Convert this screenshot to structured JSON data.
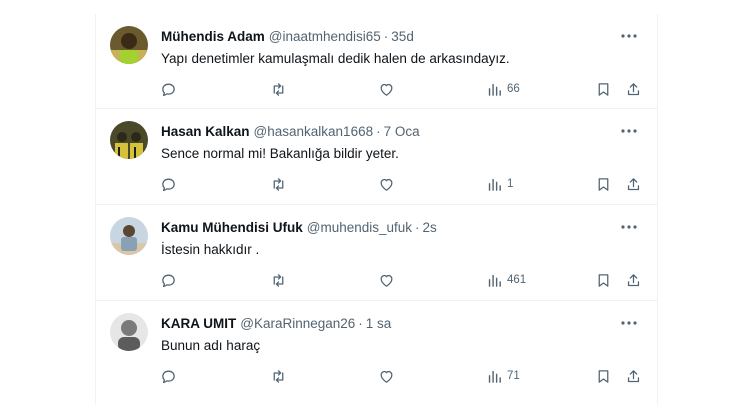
{
  "tweets": [
    {
      "name": "Mühendis Adam",
      "handle": "@inaatmhendisi65",
      "time": "35d",
      "text": "Yapı denetimler kamulaşmalı dedik halen de arkasındayız.",
      "views": "66",
      "avatar_colors": [
        "#6b5a2e",
        "#c9b255"
      ]
    },
    {
      "name": "Hasan Kalkan",
      "handle": "@hasankalkan1668",
      "time": "7 Oca",
      "text": "Sence normal mi! Bakanlığa bildir yeter.",
      "views": "1",
      "avatar_colors": [
        "#4a4a2a",
        "#d6c23a"
      ]
    },
    {
      "name": "Kamu Mühendisi Ufuk",
      "handle": "@muhendis_ufuk",
      "time": "2s",
      "text": "İstesin hakkıdır .",
      "views": "461",
      "avatar_colors": [
        "#9fb3c4",
        "#d9c7a8"
      ]
    },
    {
      "name": "KARA UMIT",
      "handle": "@KaraRinnegan26",
      "time": "1 sa",
      "text": "Bunun adı haraç",
      "views": "71",
      "avatar_colors": [
        "#7a7a7a",
        "#e6e6e6"
      ]
    }
  ],
  "icons": {
    "reply": "reply-icon",
    "retweet": "retweet-icon",
    "like": "like-icon",
    "views": "views-icon",
    "bookmark": "bookmark-icon",
    "share": "share-icon",
    "more": "more-icon"
  },
  "colors": {
    "text": "#0f1419",
    "secondary": "#536471",
    "divider": "#eff3f4"
  }
}
